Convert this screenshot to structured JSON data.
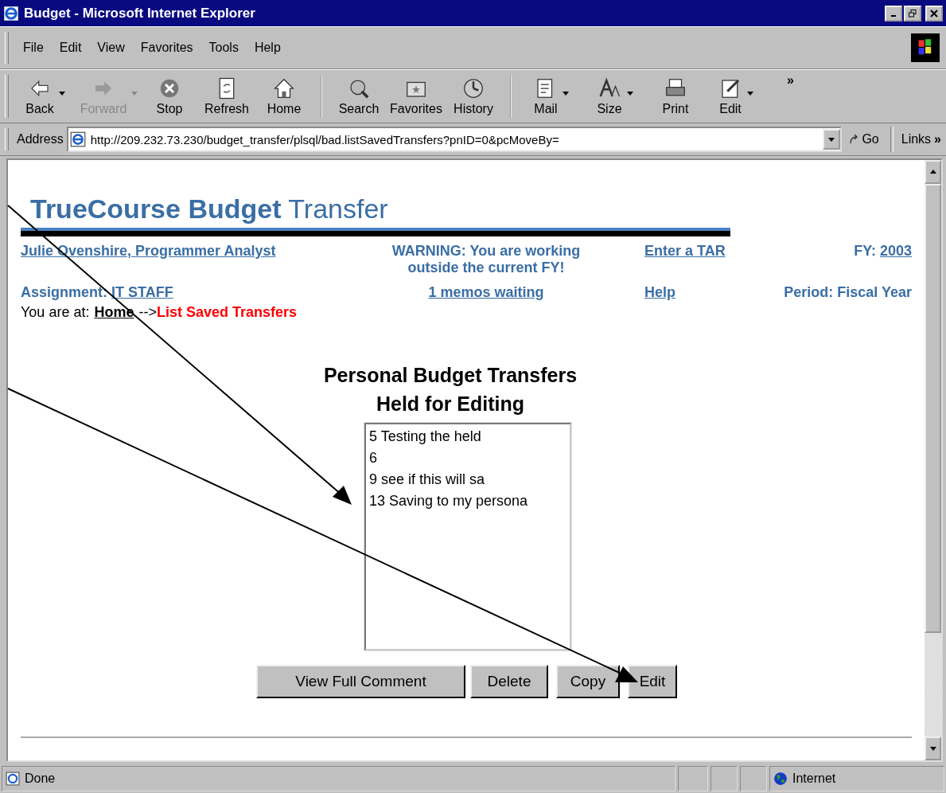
{
  "window": {
    "title": "Budget - Microsoft Internet Explorer"
  },
  "menu": [
    "File",
    "Edit",
    "View",
    "Favorites",
    "Tools",
    "Help"
  ],
  "toolbar": [
    {
      "label": "Back",
      "disabled": false,
      "dropdown": true,
      "separator_before": false
    },
    {
      "label": "Forward",
      "disabled": true,
      "dropdown": true,
      "separator_before": false
    },
    {
      "label": "Stop",
      "disabled": false,
      "dropdown": false,
      "separator_before": false
    },
    {
      "label": "Refresh",
      "disabled": false,
      "dropdown": false,
      "separator_before": false
    },
    {
      "label": "Home",
      "disabled": false,
      "dropdown": false,
      "separator_before": false
    },
    {
      "label": "Search",
      "disabled": false,
      "dropdown": false,
      "separator_before": true
    },
    {
      "label": "Favorites",
      "disabled": false,
      "dropdown": false,
      "separator_before": false
    },
    {
      "label": "History",
      "disabled": false,
      "dropdown": false,
      "separator_before": false
    },
    {
      "label": "Mail",
      "disabled": false,
      "dropdown": true,
      "separator_before": true
    },
    {
      "label": "Size",
      "disabled": false,
      "dropdown": true,
      "separator_before": false
    },
    {
      "label": "Print",
      "disabled": false,
      "dropdown": false,
      "separator_before": false
    },
    {
      "label": "Edit",
      "disabled": false,
      "dropdown": true,
      "separator_before": false
    }
  ],
  "toolbar_more": "»",
  "address": {
    "label": "Address",
    "url": "http://209.232.73.230/budget_transfer/plsql/bad.listSavedTransfers?pnID=0&pcMoveBy=",
    "go": "Go",
    "links": "Links",
    "links_more": "»"
  },
  "page": {
    "heading": "**TrueCourse Budget** Transfer",
    "user_link": "Julie Ovenshire, Programmer Analyst",
    "warning": "WARNING: You are working outside the current FY!",
    "tar_link": "Enter a TAR",
    "fy_label": "FY:",
    "fy_link": "2003",
    "assignment_label": "Assignment:",
    "assignment_link": "IT STAFF",
    "memos_link": "1 memos waiting",
    "help_link": "Help",
    "period": "Period: Fiscal Year",
    "breadcrumb": {
      "prefix": "You are at:",
      "home": "Home",
      "separator": "-->",
      "current": "List Saved Transfers"
    },
    "list_title": [
      "Personal Budget Transfers",
      "Held for Editing"
    ],
    "list_items": [
      {
        "text": "5 Testing the held",
        "selected": false
      },
      {
        "text": "6",
        "selected": false
      },
      {
        "text": "9 see if this will sa",
        "selected": false
      },
      {
        "text": "13 Saving to my persona",
        "selected": false
      }
    ],
    "buttons": [
      "View Full Comment",
      "Delete",
      "Copy",
      "Edit"
    ]
  },
  "status_bar": {
    "text": "Done",
    "zone": "Internet"
  }
}
